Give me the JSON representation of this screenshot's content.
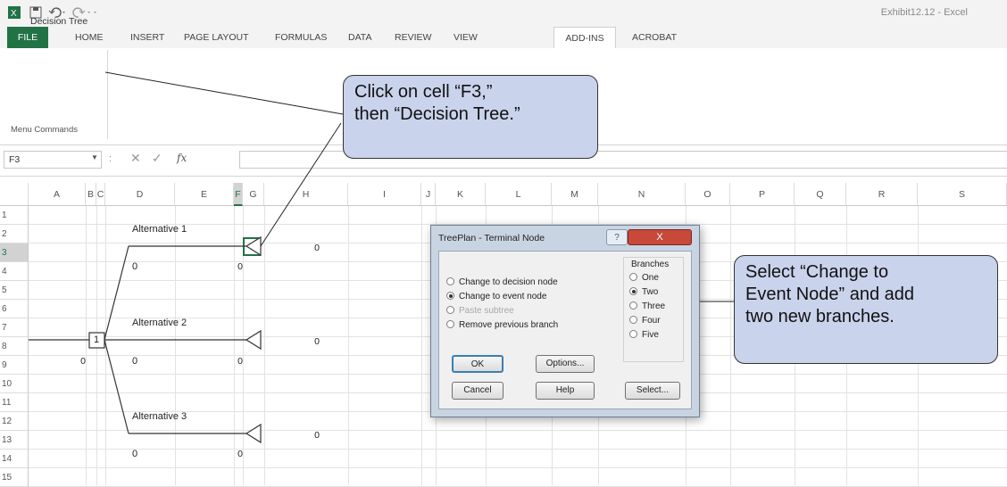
{
  "window": {
    "title": "Exhibit12.12 - Excel"
  },
  "quick_access": {
    "app_icon": "excel-icon",
    "save_icon": "save-icon",
    "undo_icon": "undo-icon",
    "redo_icon": "redo-icon"
  },
  "tabs": [
    {
      "label": "FILE"
    },
    {
      "label": "HOME"
    },
    {
      "label": "INSERT"
    },
    {
      "label": "PAGE LAYOUT"
    },
    {
      "label": "FORMULAS"
    },
    {
      "label": "DATA"
    },
    {
      "label": "REVIEW"
    },
    {
      "label": "VIEW"
    },
    {
      "label": "ADD-INS"
    },
    {
      "label": "ACROBAT"
    }
  ],
  "ribbon": {
    "decision_tree": "Decision Tree",
    "group_label": "Menu Commands"
  },
  "formula_bar": {
    "name_box": "F3",
    "colon": ":",
    "cancel": "✕",
    "enter": "✓",
    "fx": "fx",
    "value": ""
  },
  "columns": [
    "A",
    "B",
    "C",
    "D",
    "E",
    "F",
    "G",
    "H",
    "I",
    "J",
    "K",
    "L",
    "M",
    "N",
    "O",
    "P",
    "Q",
    "R",
    "S"
  ],
  "rows": [
    "1",
    "2",
    "3",
    "4",
    "5",
    "6",
    "7",
    "8",
    "9",
    "10",
    "11",
    "12",
    "13",
    "14",
    "15"
  ],
  "cells": {
    "d2": "Alternative 1",
    "g3": "0",
    "d4": "0",
    "e4": "0",
    "d7": "Alternative 2",
    "b8": "1",
    "g8": "0",
    "a9": "0",
    "d9": "0",
    "e9": "0",
    "d12": "Alternative 3",
    "g13": "0",
    "d14": "0",
    "e14": "0"
  },
  "dialog": {
    "title": "TreePlan - Terminal Node",
    "help_icon": "?",
    "close_icon": "X",
    "options": [
      {
        "label": "Change to decision node",
        "selected": false,
        "enabled": true
      },
      {
        "label": "Change to event node",
        "selected": true,
        "enabled": true
      },
      {
        "label": "Paste subtree",
        "selected": false,
        "enabled": false
      },
      {
        "label": "Remove previous branch",
        "selected": false,
        "enabled": true
      }
    ],
    "branches_label": "Branches",
    "branches": [
      {
        "label": "One",
        "selected": false
      },
      {
        "label": "Two",
        "selected": true
      },
      {
        "label": "Three",
        "selected": false
      },
      {
        "label": "Four",
        "selected": false
      },
      {
        "label": "Five",
        "selected": false
      }
    ],
    "buttons": {
      "ok": "OK",
      "options": "Options...",
      "cancel": "Cancel",
      "help": "Help",
      "select": "Select..."
    }
  },
  "callouts": {
    "top": {
      "line1": "Click on cell “F3,”",
      "line2": "then “Decision Tree.”"
    },
    "right": {
      "line1": "Select “Change to",
      "line2": "Event Node” and add",
      "line3": "two new branches."
    }
  },
  "colors": {
    "excel_green": "#217346",
    "callout_fill": "#cad3ec",
    "close_red": "#c8483a"
  }
}
